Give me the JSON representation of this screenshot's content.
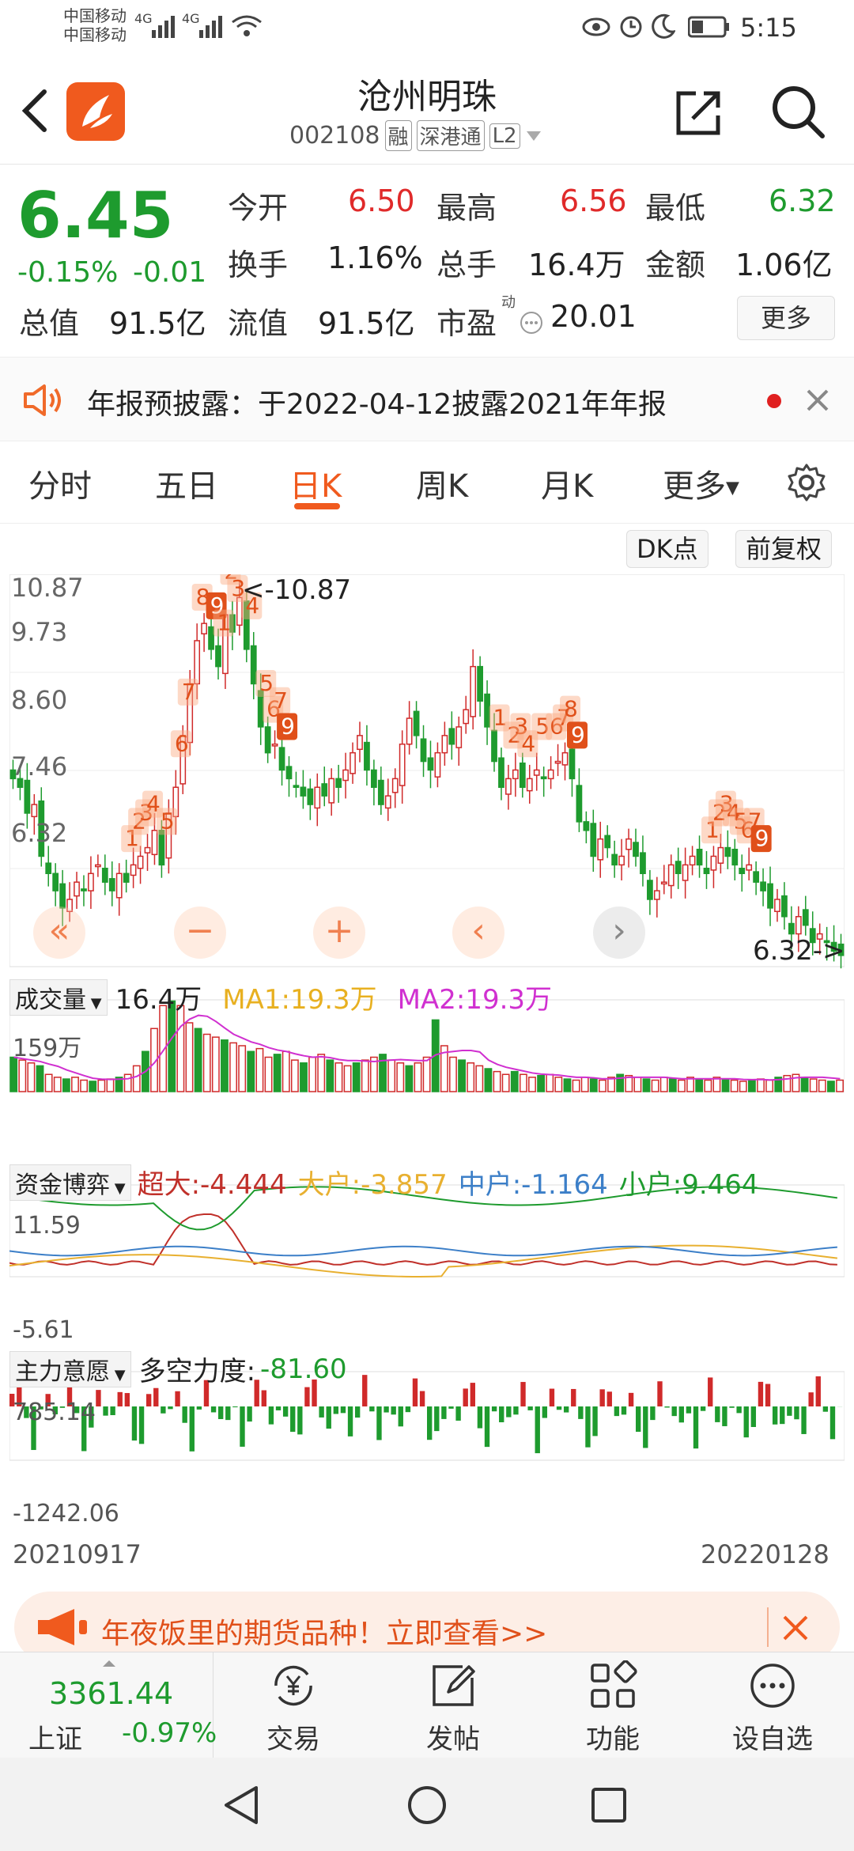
{
  "status": {
    "carrier1": "中国移动",
    "carrier2": "中国移动",
    "net1": "4G",
    "net2": "4G",
    "time": "5:15"
  },
  "header": {
    "title": "沧州明珠",
    "code": "002108",
    "tags": [
      "融",
      "深港通",
      "L2"
    ]
  },
  "quote": {
    "price": "6.45",
    "pct": "-0.15%",
    "change": "-0.01",
    "rows": [
      [
        {
          "label": "今开",
          "value": "6.50",
          "color": "#e02a2a"
        },
        {
          "label": "最高",
          "value": "6.56",
          "color": "#e02a2a"
        },
        {
          "label": "最低",
          "value": "6.32",
          "color": "#1e9b2e"
        }
      ],
      [
        {
          "label": "换手",
          "value": "1.16%",
          "color": "#222"
        },
        {
          "label": "总手",
          "value": "16.4万",
          "color": "#222"
        },
        {
          "label": "金额",
          "value": "1.06亿",
          "color": "#222"
        }
      ]
    ],
    "row3": {
      "total_label": "总值",
      "total_value": "91.5亿",
      "float_label": "流值",
      "float_value": "91.5亿",
      "pe_label": "市盈",
      "pe_sup": "动",
      "pe_value": "20.01"
    },
    "more": "更多"
  },
  "notice": {
    "text": "年报预披露：于2022-04-12披露2021年年报"
  },
  "tabs": [
    "分时",
    "五日",
    "日K",
    "周K",
    "月K",
    "更多"
  ],
  "active_tab": 2,
  "chart_buttons": [
    "DK点",
    "前复权"
  ],
  "chart_data": [
    {
      "type": "candlestick",
      "ylim": [
        6.32,
        10.87
      ],
      "ytick_labels": [
        "10.87",
        "9.73",
        "8.60",
        "7.46",
        "6.32"
      ],
      "high_marker": "<-10.87",
      "low_marker": "6.32->",
      "close": [
        8.5,
        8.4,
        8.1,
        8.2,
        7.6,
        7.4,
        7.2,
        7.0,
        7.1,
        7.3,
        7.2,
        7.4,
        7.5,
        7.3,
        7.2,
        7.4,
        7.3,
        7.5,
        7.6,
        7.7,
        7.9,
        7.5,
        8.1,
        8.4,
        9.0,
        9.6,
        10.1,
        10.3,
        10.0,
        9.8,
        10.4,
        10.2,
        10.6,
        10.0,
        9.6,
        9.1,
        8.8,
        8.9,
        8.6,
        8.5,
        8.4,
        8.3,
        8.2,
        8.4,
        8.3,
        8.5,
        8.4,
        8.6,
        8.8,
        9.0,
        8.6,
        8.4,
        8.2,
        8.3,
        8.5,
        8.9,
        9.2,
        9.0,
        8.7,
        8.6,
        8.8,
        9.0,
        8.9,
        9.1,
        9.3,
        9.8,
        9.4,
        9.1,
        8.7,
        8.4,
        8.5,
        8.6,
        8.4,
        8.5,
        8.6,
        8.5,
        8.6,
        8.7,
        8.8,
        8.5,
        8.0,
        7.9,
        7.6,
        7.8,
        7.7,
        7.5,
        7.6,
        7.8,
        7.6,
        7.4,
        7.1,
        7.2,
        7.3,
        7.5,
        7.4,
        7.5,
        7.6,
        7.5,
        7.4,
        7.6,
        7.7,
        7.6,
        7.5,
        7.4,
        7.5,
        7.3,
        7.2,
        7.0,
        7.1,
        6.9,
        6.7,
        6.9,
        6.8,
        6.6,
        6.7,
        6.6,
        6.5,
        6.45
      ],
      "signals": [
        "1",
        "2",
        "3",
        "4",
        "5",
        "6",
        "7",
        "8",
        "9",
        "1",
        "2",
        "3",
        "4",
        "5",
        "6",
        "7",
        "9",
        "1",
        "2",
        "3",
        "4",
        "5",
        "6",
        "7",
        "8",
        "9",
        "1",
        "2",
        "3",
        "4",
        "5",
        "6",
        "7",
        "9"
      ]
    },
    {
      "type": "bar",
      "title": "成交量",
      "value": "16.4万",
      "ma1": "MA1:19.3万",
      "ma2": "MA2:19.3万",
      "ymax_label": "159万",
      "values": [
        60,
        55,
        50,
        45,
        30,
        25,
        22,
        25,
        20,
        18,
        20,
        22,
        25,
        30,
        45,
        70,
        110,
        150,
        158,
        150,
        120,
        110,
        100,
        95,
        90,
        85,
        80,
        70,
        75,
        60,
        65,
        70,
        55,
        50,
        60,
        65,
        55,
        50,
        45,
        50,
        55,
        60,
        65,
        55,
        50,
        45,
        50,
        60,
        125,
        80,
        60,
        55,
        50,
        45,
        40,
        35,
        30,
        35,
        30,
        25,
        28,
        30,
        25,
        22,
        20,
        25,
        22,
        20,
        25,
        30,
        28,
        25,
        22,
        20,
        25,
        22,
        20,
        25,
        22,
        20,
        25,
        22,
        20,
        18,
        20,
        22,
        20,
        25,
        28,
        30,
        25,
        22,
        20,
        18,
        20
      ]
    },
    {
      "type": "line",
      "title": "资金博弈",
      "ytick_labels": [
        "11.59",
        "-5.61"
      ],
      "series": [
        {
          "name": "超大:-4.444",
          "color": "#c0302a"
        },
        {
          "name": "大户:-3.857",
          "color": "#e8b030"
        },
        {
          "name": "中户:-1.164",
          "color": "#3c7fc8"
        },
        {
          "name": "小户:9.464",
          "color": "#1e9b2e"
        }
      ]
    },
    {
      "type": "bar",
      "title": "主力意愿",
      "value_label": "多空力度:",
      "value": "-81.60",
      "ytick_labels": [
        "785.14",
        "-1242.06"
      ],
      "x_start": "20210917",
      "x_end": "20220128"
    }
  ],
  "banner": {
    "text": "年夜饭里的期货品种！立即查看>>"
  },
  "bottom_nav": {
    "index_value": "3361.44",
    "index_name": "上证",
    "index_pct": "-0.97%",
    "items": [
      "交易",
      "发帖",
      "功能",
      "设自选"
    ]
  }
}
